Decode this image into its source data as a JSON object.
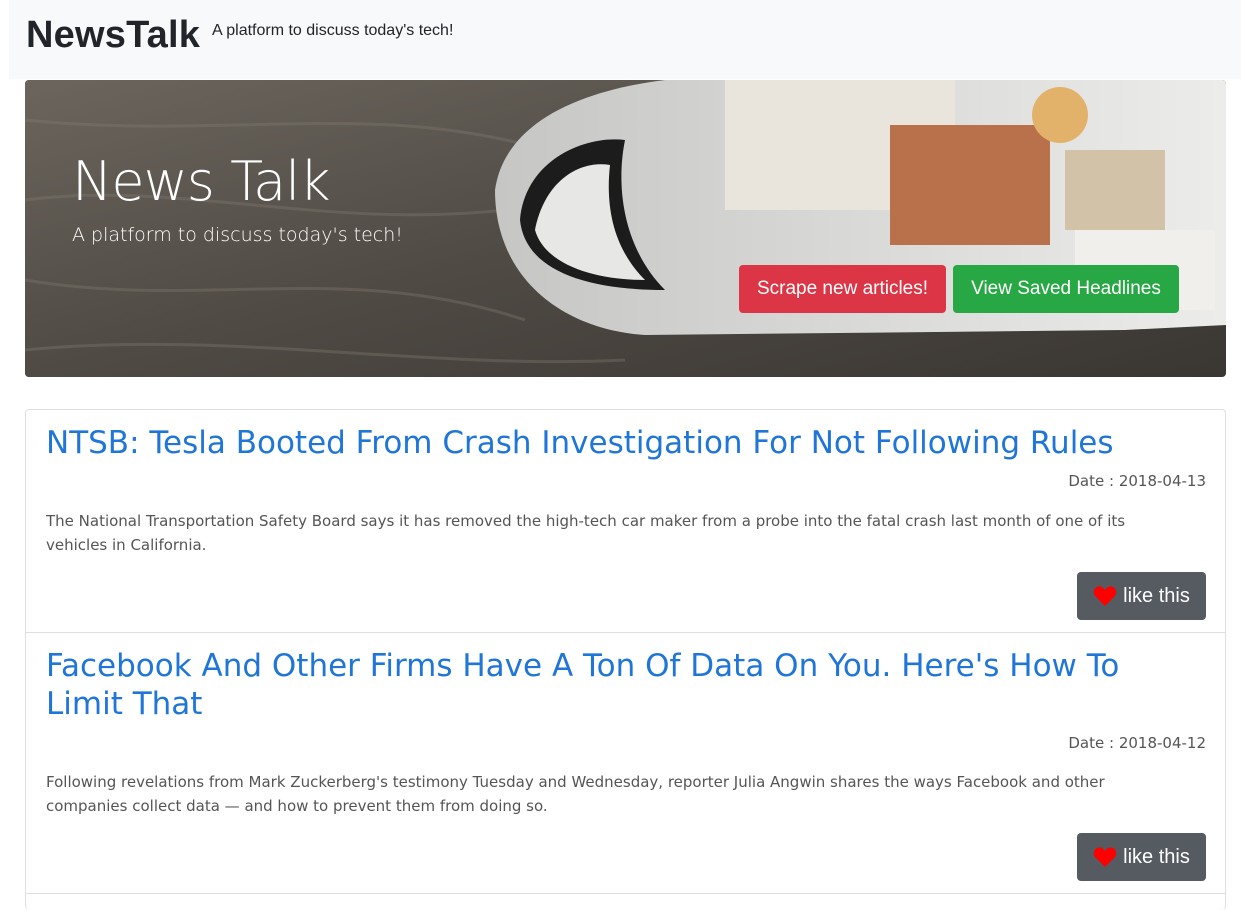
{
  "navbar": {
    "brand": "NewsTalk",
    "tagline": "A platform to discuss today's tech!"
  },
  "hero": {
    "title": "News Talk",
    "subtitle": "A platform to discuss today's tech!",
    "scrape_button": "Scrape new articles!",
    "saved_button": "View Saved Headlines"
  },
  "articles": [
    {
      "headline": "NTSB: Tesla Booted From Crash Investigation For Not Following Rules",
      "date": "Date : 2018-04-13",
      "summary": "The National Transportation Safety Board says it has removed the high-tech car maker from a probe into the fatal crash last month of one of its vehicles in California.",
      "like_label": "like this",
      "like_icon": "heart-icon"
    },
    {
      "headline": "Facebook And Other Firms Have A Ton Of Data On You. Here's How To Limit That",
      "date": "Date : 2018-04-12",
      "summary": "Following revelations from Mark Zuckerberg's testimony Tuesday and Wednesday, reporter Julia Angwin shares the ways Facebook and other companies collect data — and how to prevent them from doing so.",
      "like_label": "like this",
      "like_icon": "heart-icon"
    }
  ],
  "colors": {
    "danger": "#dc3545",
    "success": "#28a745",
    "link": "#1f76d8",
    "like_button": "#555b61",
    "heart": "#ff0000"
  }
}
